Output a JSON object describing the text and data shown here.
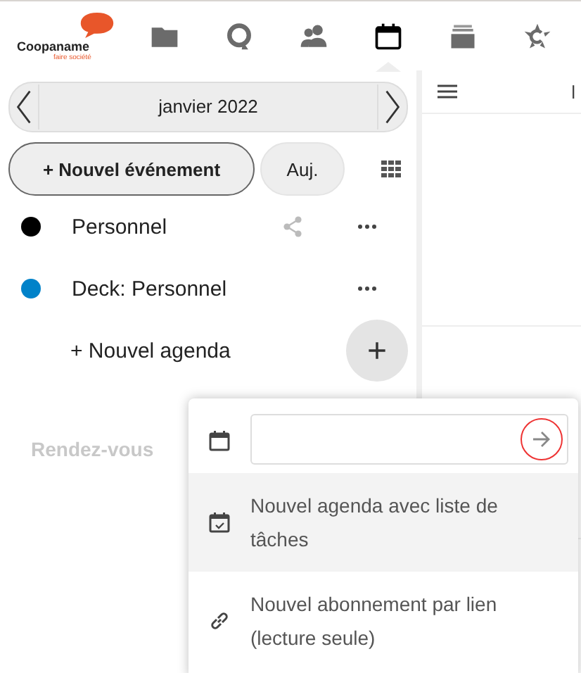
{
  "header": {
    "logo": {
      "name": "Coopaname",
      "tagline": "faire société"
    },
    "apps": [
      {
        "kind": "folder",
        "selected": false
      },
      {
        "kind": "circle",
        "selected": false
      },
      {
        "kind": "people",
        "selected": false
      },
      {
        "kind": "calendar",
        "selected": true
      },
      {
        "kind": "stack",
        "selected": false
      },
      {
        "kind": "star",
        "selected": false
      }
    ]
  },
  "sidebar": {
    "month": "janvier 2022",
    "new_event": "+ Nouvel événement",
    "today": "Auj.",
    "calendars": [
      {
        "name": "Personnel",
        "color": "#000000",
        "shared": true
      },
      {
        "name": "Deck: Personnel",
        "color": "#0082c9",
        "shared": false
      }
    ],
    "new_calendar": "+ Nouvel agenda",
    "section": "Rendez-vous"
  },
  "main": {
    "weekday": "l"
  },
  "popover": {
    "items": [
      {
        "kind": "input"
      },
      {
        "kind": "option",
        "label": "Nouvel agenda avec liste de tâches",
        "selected": true
      },
      {
        "kind": "option",
        "label": "Nouvel abonnement par lien (lecture seule)",
        "selected": false
      }
    ]
  }
}
